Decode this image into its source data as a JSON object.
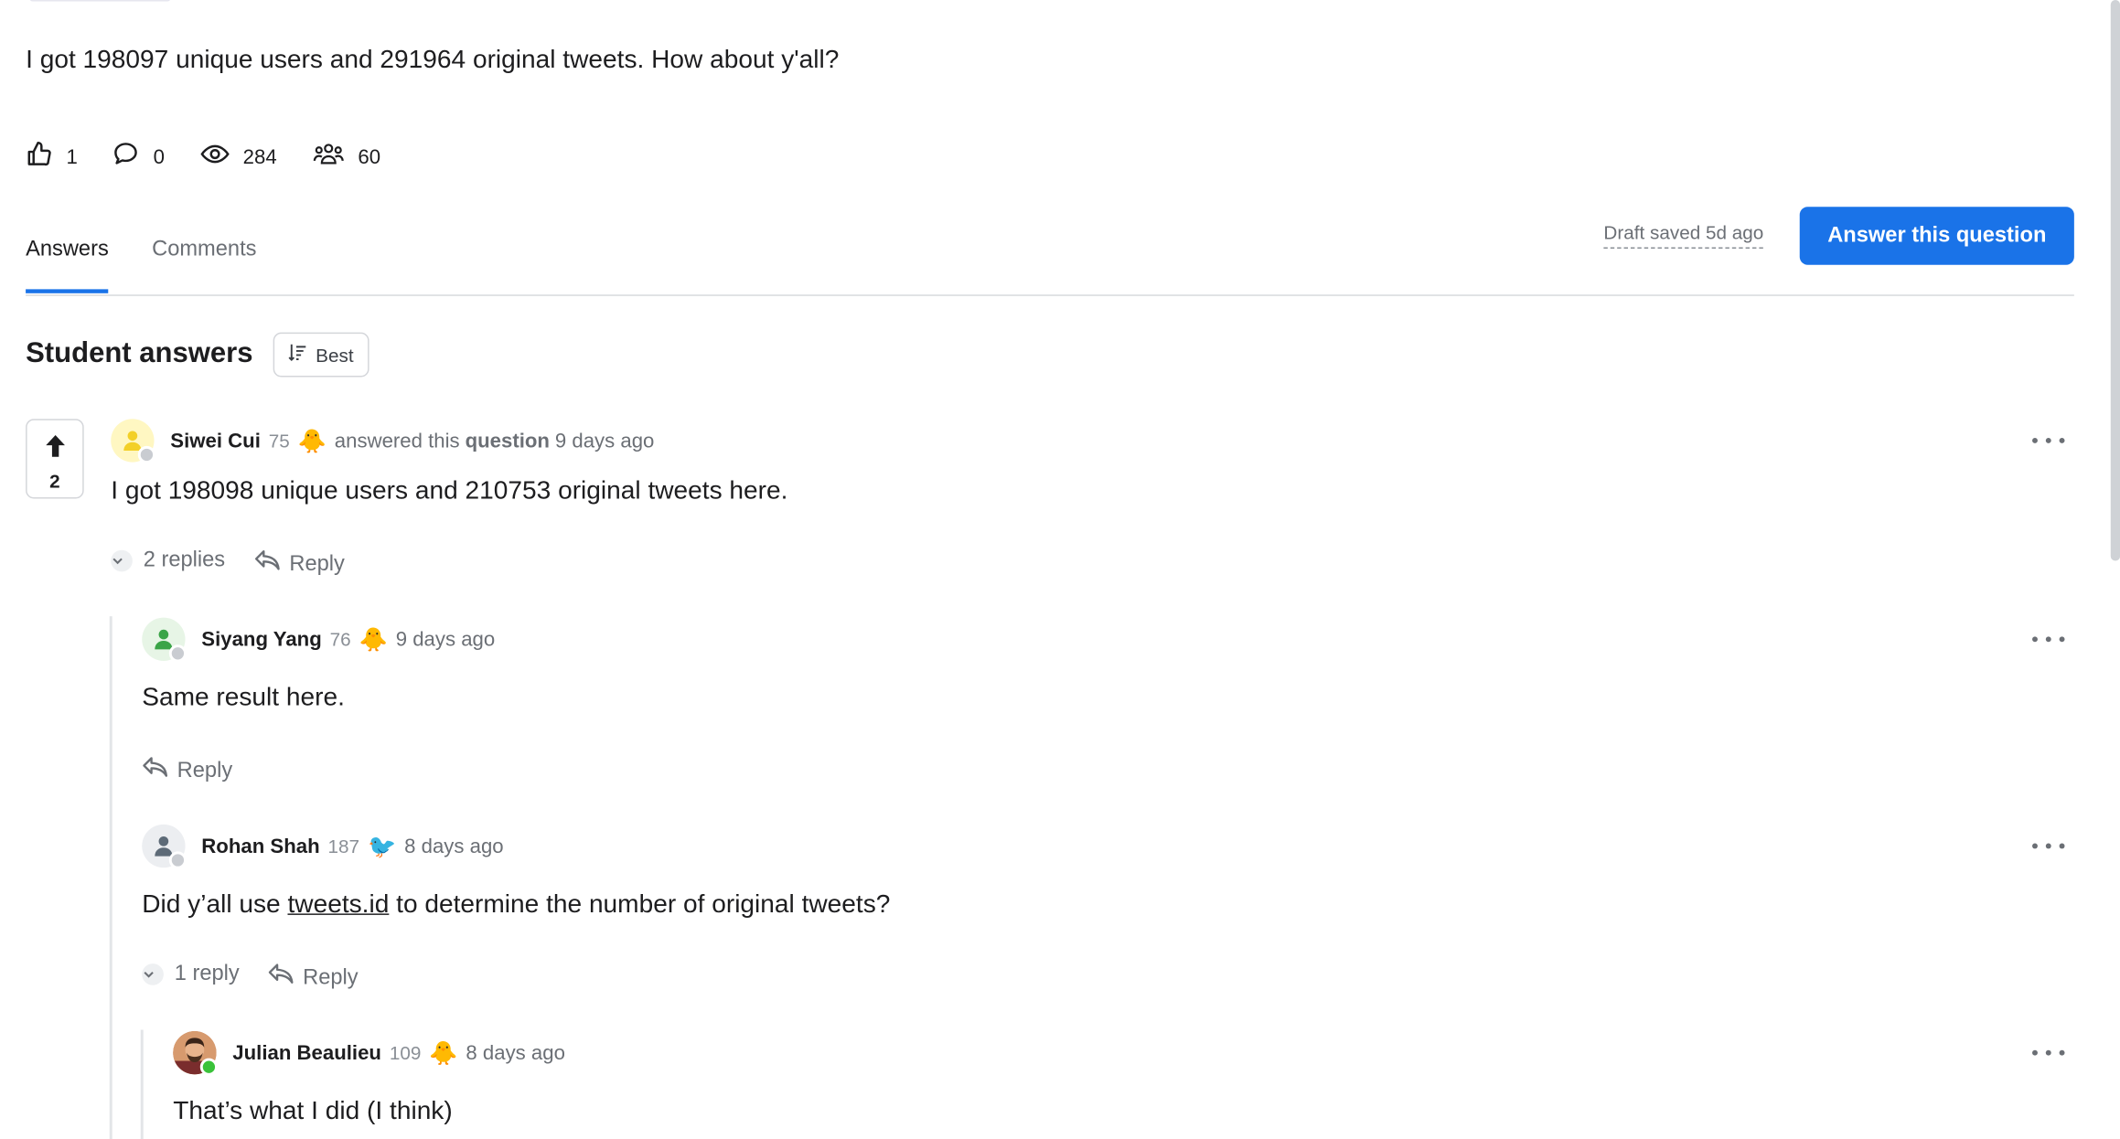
{
  "question": {
    "text": "I got 198097 unique users and 291964 original tweets. How about y'all?",
    "stats": {
      "likes": "1",
      "comments": "0",
      "views": "284",
      "followers": "60"
    }
  },
  "tabs": [
    {
      "label": "Answers"
    },
    {
      "label": "Comments"
    }
  ],
  "draft_status": "Draft saved 5d ago",
  "answer_button": "Answer this question",
  "section": {
    "title": "Student answers",
    "sort_label": "Best"
  },
  "answer": {
    "votes": "2",
    "author": "Siwei Cui",
    "reputation": "75",
    "badge": "chick",
    "action_prefix": "answered this",
    "action_object": "question",
    "time": "9 days ago",
    "text": "I got 198098 unique users and 210753 original tweets here.",
    "replies_toggle": "2 replies",
    "reply_label": "Reply"
  },
  "replies": [
    {
      "author": "Siyang Yang",
      "reputation": "76",
      "badge": "chick",
      "time": "9 days ago",
      "text": "Same result here.",
      "reply_label": "Reply"
    },
    {
      "author": "Rohan Shah",
      "reputation": "187",
      "badge": "bird",
      "time": "8 days ago",
      "text_before": "Did y’all use ",
      "text_link": "tweets.id",
      "text_after": " to determine the number of original tweets?",
      "replies_toggle": "1 reply",
      "reply_label": "Reply"
    }
  ],
  "nested_reply": {
    "author": "Julian Beaulieu",
    "reputation": "109",
    "badge": "chick",
    "time": "8 days ago",
    "text": "That’s what I did (I think)"
  },
  "colors": {
    "accent": "#1a73e8",
    "muted": "#6b6f75",
    "online": "#3ac23a"
  }
}
